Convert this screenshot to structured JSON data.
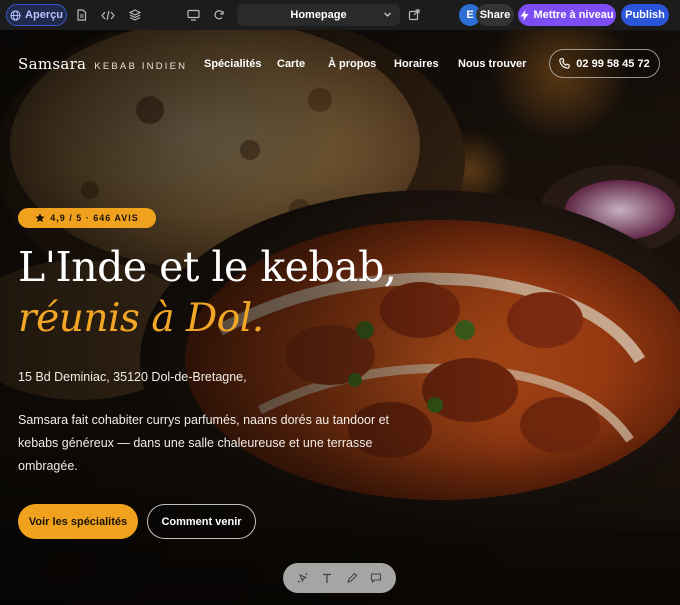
{
  "editor": {
    "preview_label": "Aperçu",
    "page_name": "Homepage",
    "avatar_initial": "E",
    "share_label": "Share",
    "upgrade_label": "Mettre à niveau",
    "publish_label": "Publish",
    "colors": {
      "upgrade": "#7b4df2",
      "publish": "#2a55d9",
      "preview": "#3b55c9"
    }
  },
  "site": {
    "brand_name": "Samsara",
    "brand_sub": "KEBAB INDIEN",
    "nav": [
      "Spécialités",
      "Carte",
      "À propos",
      "Horaires",
      "Nous trouver"
    ],
    "phone": "02 99 58 45 72",
    "rating": "4,9 / 5 · 646 AVIS",
    "headline_1": "L'Inde et le kebab,",
    "headline_2": "réunis à Dol.",
    "address": "15 Bd Deminiac, 35120 Dol-de-Bretagne,",
    "description": "Samsara fait cohabiter currys parfumés, naans dorés au tandoor et kebabs généreux — dans une salle chaleureuse et une terrasse ombragée.",
    "cta_primary": "Voir les spécialités",
    "cta_secondary": "Comment venir",
    "accent_color": "#f0a21e"
  },
  "edit_toolbar": {
    "icons": [
      "magic-select-icon",
      "text-icon",
      "pen-icon",
      "comment-icon"
    ]
  }
}
